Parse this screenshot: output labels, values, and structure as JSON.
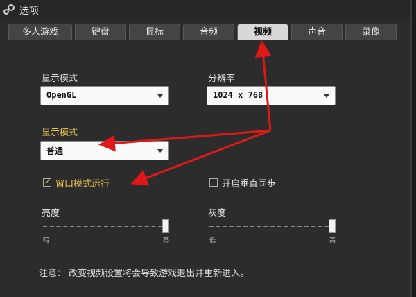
{
  "window": {
    "title": "选项"
  },
  "tabs": [
    {
      "label": "多人游戏",
      "active": false
    },
    {
      "label": "键盘",
      "active": false
    },
    {
      "label": "鼠标",
      "active": false
    },
    {
      "label": "音频",
      "active": false
    },
    {
      "label": "视频",
      "active": true
    },
    {
      "label": "声音",
      "active": false
    },
    {
      "label": "录像",
      "active": false
    }
  ],
  "video": {
    "display_mode_label": "显示模式",
    "display_mode_value": "OpenGL",
    "resolution_label": "分辨率",
    "resolution_value": "1024 x 768",
    "display_mode2_label": "显示模式",
    "display_mode2_value": "普通",
    "windowed_label": "窗口模式运行",
    "windowed_checked": true,
    "vsync_label": "开启垂直同步",
    "vsync_checked": false,
    "brightness": {
      "label": "亮度",
      "min_label": "暗",
      "max_label": "亮",
      "value": 1.0
    },
    "gamma": {
      "label": "灰度",
      "min_label": "低",
      "max_label": "高",
      "value": 1.0
    },
    "note": "注意：  改变视频设置将会导致游戏退出并重新进入。"
  },
  "annotation_color": "#e01818"
}
